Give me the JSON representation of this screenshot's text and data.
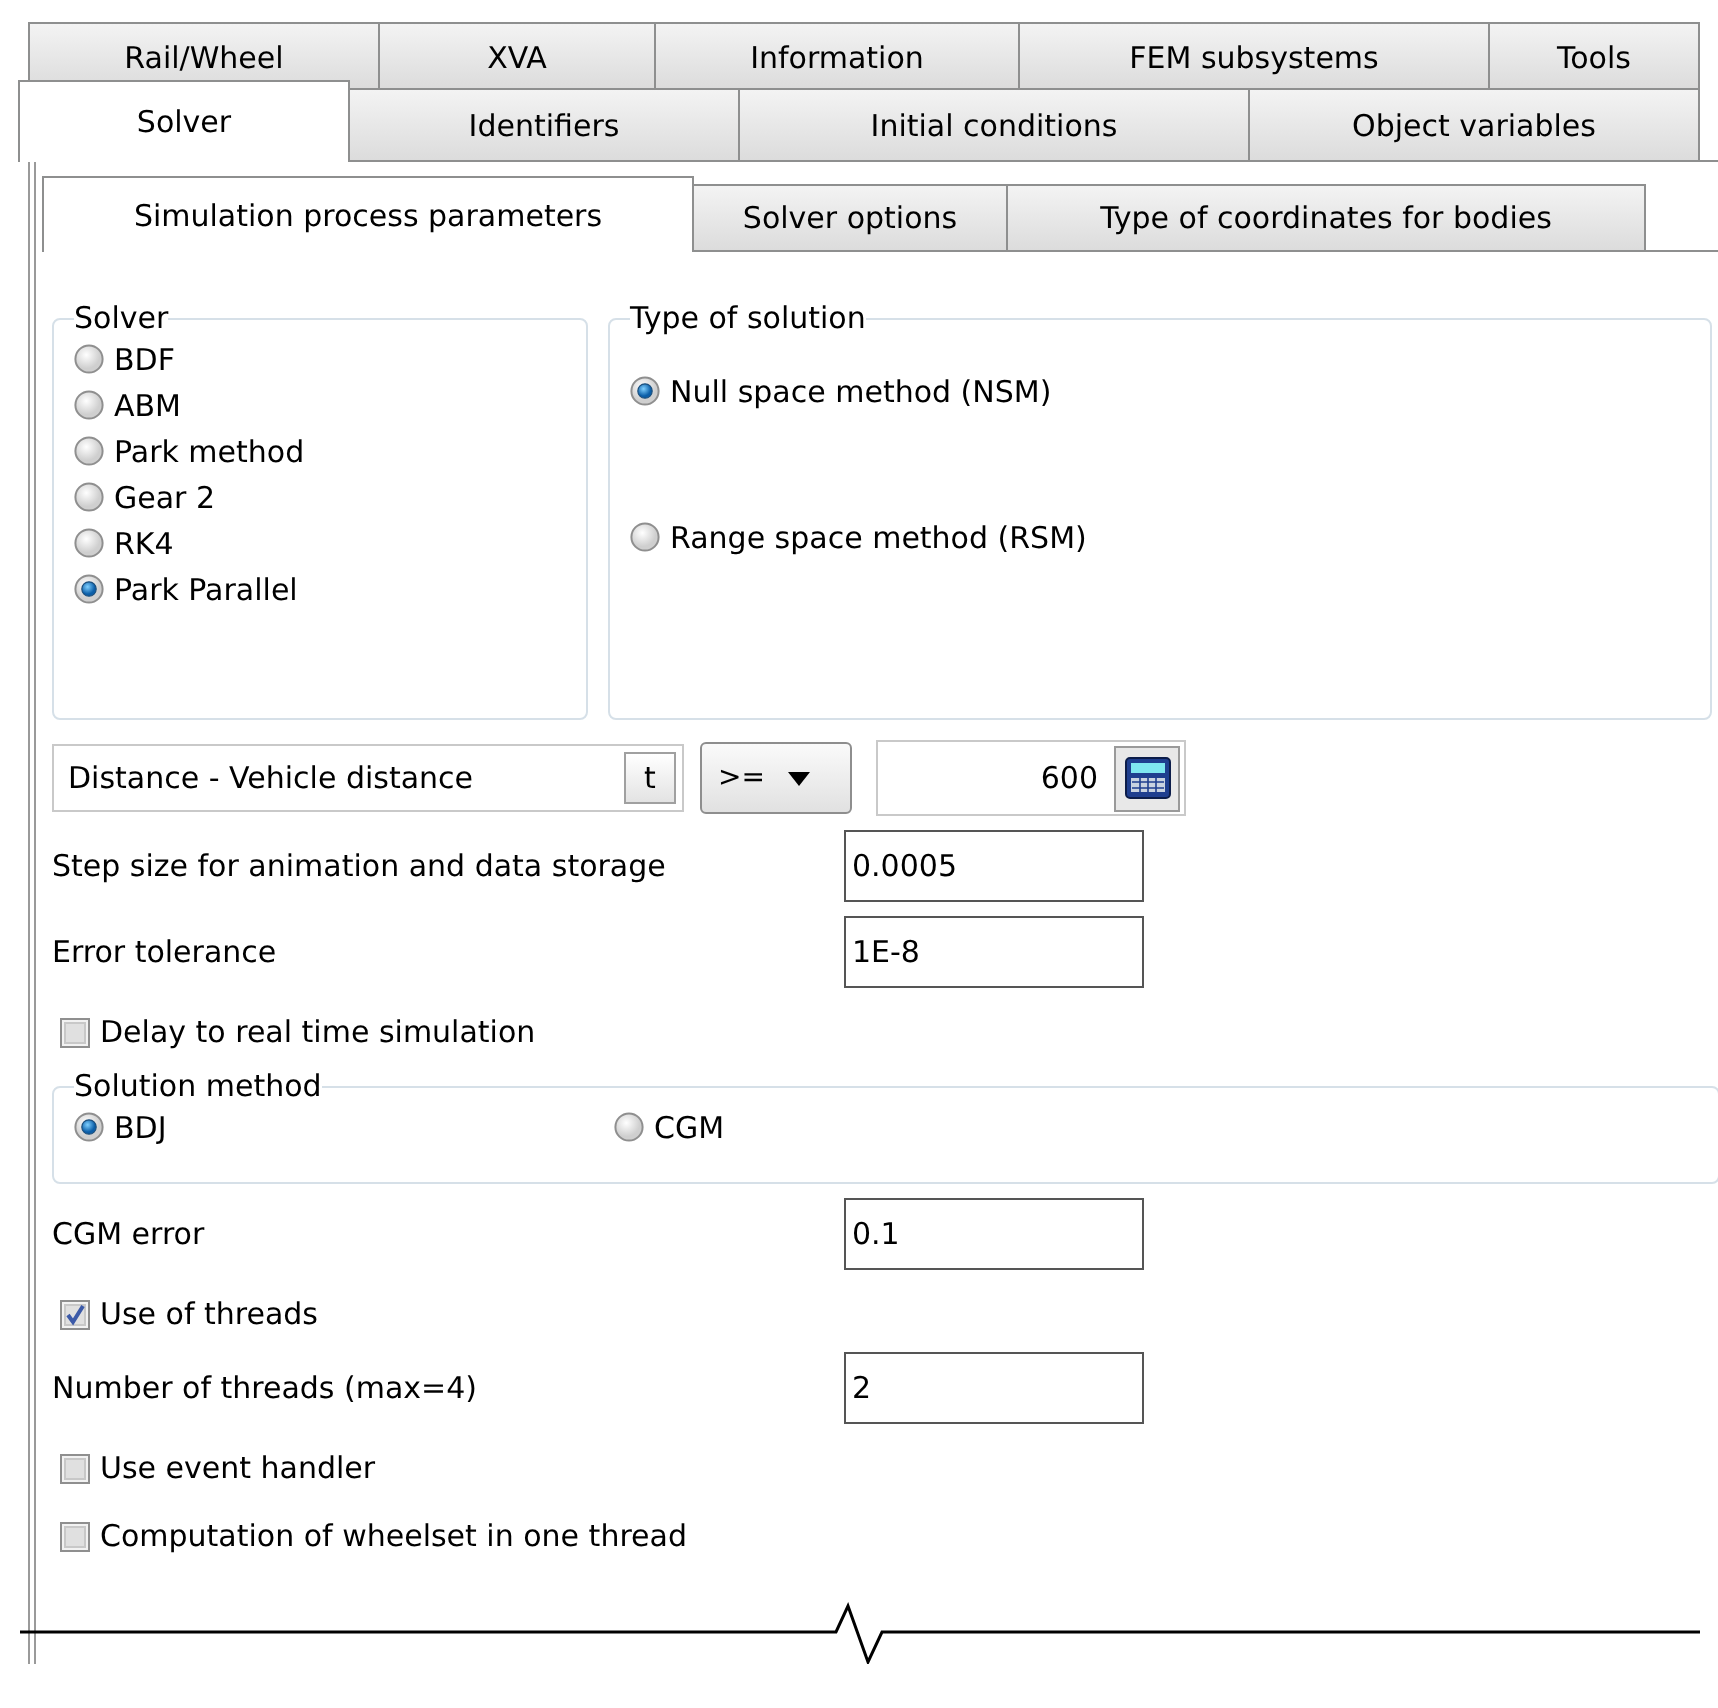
{
  "tabs_row_1": [
    {
      "label": "Rail/Wheel",
      "selected": false
    },
    {
      "label": "XVA",
      "selected": false
    },
    {
      "label": "Information",
      "selected": false
    },
    {
      "label": "FEM subsystems",
      "selected": false
    },
    {
      "label": "Tools",
      "selected": false
    }
  ],
  "tabs_row_2": [
    {
      "label": "Solver",
      "selected": true
    },
    {
      "label": "Identifiers",
      "selected": false
    },
    {
      "label": "Initial conditions",
      "selected": false
    },
    {
      "label": "Object variables",
      "selected": false
    }
  ],
  "sub_tabs": [
    {
      "label": "Simulation process parameters",
      "selected": true
    },
    {
      "label": "Solver options",
      "selected": false
    },
    {
      "label": "Type of coordinates for bodies",
      "selected": false
    }
  ],
  "solver_group": {
    "title": "Solver",
    "options": [
      {
        "label": "BDF",
        "selected": false
      },
      {
        "label": "ABM",
        "selected": false
      },
      {
        "label": "Park method",
        "selected": false
      },
      {
        "label": "Gear 2",
        "selected": false
      },
      {
        "label": "RK4",
        "selected": false
      },
      {
        "label": "Park Parallel",
        "selected": true
      }
    ]
  },
  "solution_type_group": {
    "title": "Type of solution",
    "options": [
      {
        "label": "Null space method (NSM)",
        "selected": true
      },
      {
        "label": "Range space method (RSM)",
        "selected": false
      }
    ]
  },
  "end_condition": {
    "variable": "Distance - Vehicle distance",
    "variable_button": "t",
    "operator": ">=",
    "value": "600"
  },
  "step_size": {
    "label": "Step size for animation and data storage",
    "value": "0.0005"
  },
  "error_tolerance": {
    "label": "Error tolerance",
    "value": "1E-8"
  },
  "delay_real_time": {
    "label": "Delay to real time simulation",
    "checked": false
  },
  "solution_method_group": {
    "title": "Solution method",
    "options": [
      {
        "label": "BDJ",
        "selected": true
      },
      {
        "label": "CGM",
        "selected": false
      }
    ]
  },
  "cgm_error": {
    "label": "CGM error",
    "value": "0.1"
  },
  "use_threads": {
    "label": "Use of threads",
    "checked": true
  },
  "thread_count": {
    "label": "Number of threads (max=4)",
    "value": "2"
  },
  "event_handler": {
    "label": "Use event handler",
    "checked": false
  },
  "wheelset_one_thread": {
    "label": "Computation of wheelset in one thread",
    "checked": false
  }
}
